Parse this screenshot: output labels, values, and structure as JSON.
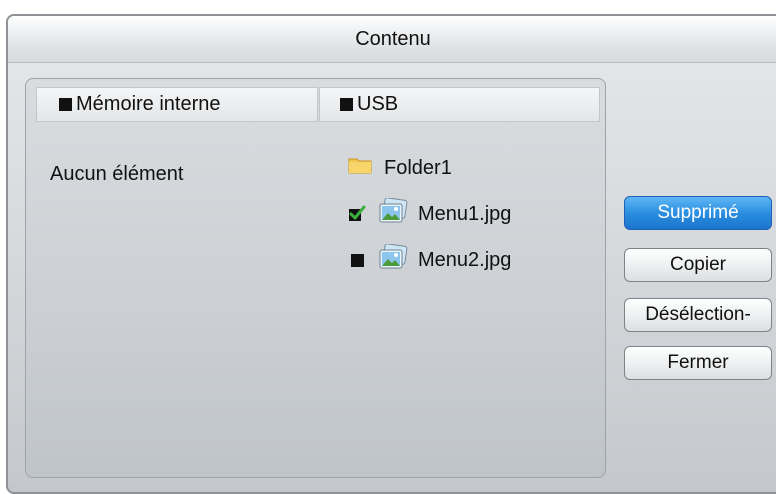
{
  "dialog": {
    "title": "Contenu"
  },
  "columns": {
    "left_header": "Mémoire interne",
    "right_header": "USB",
    "left_empty_text": "Aucun élément"
  },
  "usb_items": [
    {
      "label": "Folder1",
      "type": "folder",
      "checked": null
    },
    {
      "label": "Menu1.jpg",
      "type": "image",
      "checked": true
    },
    {
      "label": "Menu2.jpg",
      "type": "image",
      "checked": false
    }
  ],
  "buttons": {
    "delete": "Supprimé",
    "copy": "Copier",
    "deselect": "Désélection-",
    "close": "Fermer"
  },
  "colors": {
    "accent": "#2b8fe0",
    "check": "#2c9a2c",
    "folder": "#f0c24a"
  }
}
